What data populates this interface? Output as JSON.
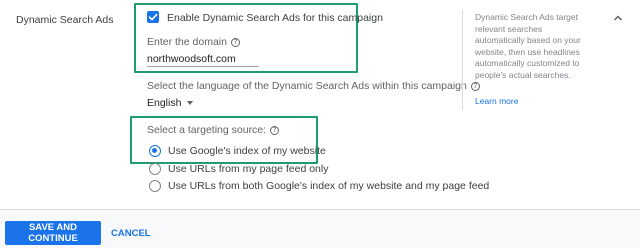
{
  "section": {
    "title": "Dynamic Search Ads"
  },
  "enable": {
    "label": "Enable Dynamic Search Ads for this campaign",
    "checked": true
  },
  "domain": {
    "label": "Enter the domain",
    "value": "northwoodsoft.com"
  },
  "language": {
    "label": "Select the language of the Dynamic Search Ads within this campaign",
    "selected": "English"
  },
  "targeting": {
    "label": "Select a targeting source:",
    "options": [
      {
        "label": "Use Google's index of my website",
        "selected": true
      },
      {
        "label": "Use URLs from my page feed only",
        "selected": false
      },
      {
        "label": "Use URLs from both Google's index of my website and my page feed",
        "selected": false
      }
    ]
  },
  "help": {
    "text": "Dynamic Search Ads target relevant searches automatically based on your website, then use headlines automatically customized to people's actual searches.",
    "link": "Learn more"
  },
  "footer": {
    "save_label": "SAVE AND CONTINUE",
    "cancel_label": "CANCEL"
  },
  "colors": {
    "accent": "#1a73e8",
    "highlight_box": "#1f9d6b"
  },
  "icons": {
    "help": "help-circle-icon",
    "collapse": "chevron-up-icon",
    "dropdown": "caret-down-icon"
  }
}
